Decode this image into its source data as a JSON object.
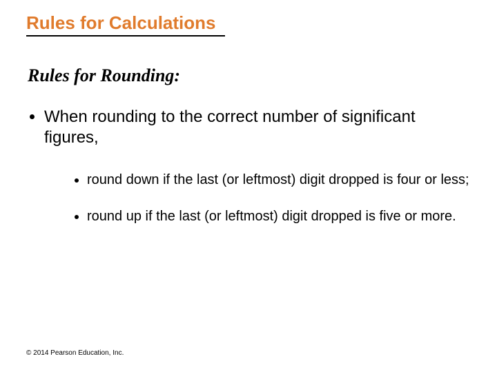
{
  "title": "Rules for Calculations",
  "subtitle": "Rules for Rounding:",
  "bullets": {
    "main": "When rounding to the correct number of significant figures,",
    "sub1": "round down if the last (or leftmost) digit dropped is four or less;",
    "sub2": "round up if the last (or leftmost) digit dropped is five or more."
  },
  "footer": "© 2014 Pearson Education, Inc."
}
